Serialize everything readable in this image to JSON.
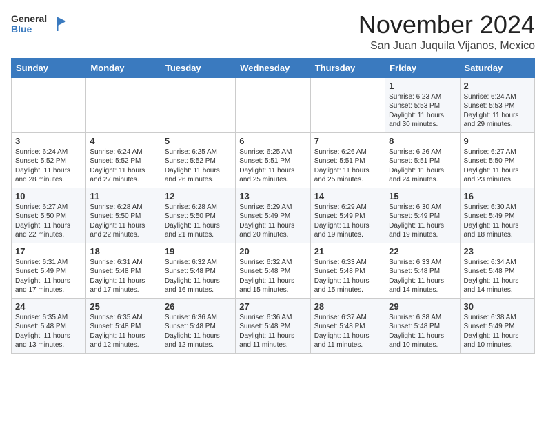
{
  "header": {
    "logo_general": "General",
    "logo_blue": "Blue",
    "month": "November 2024",
    "location": "San Juan Juquila Vijanos, Mexico"
  },
  "weekdays": [
    "Sunday",
    "Monday",
    "Tuesday",
    "Wednesday",
    "Thursday",
    "Friday",
    "Saturday"
  ],
  "weeks": [
    [
      {
        "day": "",
        "info": ""
      },
      {
        "day": "",
        "info": ""
      },
      {
        "day": "",
        "info": ""
      },
      {
        "day": "",
        "info": ""
      },
      {
        "day": "",
        "info": ""
      },
      {
        "day": "1",
        "info": "Sunrise: 6:23 AM\nSunset: 5:53 PM\nDaylight: 11 hours\nand 30 minutes."
      },
      {
        "day": "2",
        "info": "Sunrise: 6:24 AM\nSunset: 5:53 PM\nDaylight: 11 hours\nand 29 minutes."
      }
    ],
    [
      {
        "day": "3",
        "info": "Sunrise: 6:24 AM\nSunset: 5:52 PM\nDaylight: 11 hours\nand 28 minutes."
      },
      {
        "day": "4",
        "info": "Sunrise: 6:24 AM\nSunset: 5:52 PM\nDaylight: 11 hours\nand 27 minutes."
      },
      {
        "day": "5",
        "info": "Sunrise: 6:25 AM\nSunset: 5:52 PM\nDaylight: 11 hours\nand 26 minutes."
      },
      {
        "day": "6",
        "info": "Sunrise: 6:25 AM\nSunset: 5:51 PM\nDaylight: 11 hours\nand 25 minutes."
      },
      {
        "day": "7",
        "info": "Sunrise: 6:26 AM\nSunset: 5:51 PM\nDaylight: 11 hours\nand 25 minutes."
      },
      {
        "day": "8",
        "info": "Sunrise: 6:26 AM\nSunset: 5:51 PM\nDaylight: 11 hours\nand 24 minutes."
      },
      {
        "day": "9",
        "info": "Sunrise: 6:27 AM\nSunset: 5:50 PM\nDaylight: 11 hours\nand 23 minutes."
      }
    ],
    [
      {
        "day": "10",
        "info": "Sunrise: 6:27 AM\nSunset: 5:50 PM\nDaylight: 11 hours\nand 22 minutes."
      },
      {
        "day": "11",
        "info": "Sunrise: 6:28 AM\nSunset: 5:50 PM\nDaylight: 11 hours\nand 22 minutes."
      },
      {
        "day": "12",
        "info": "Sunrise: 6:28 AM\nSunset: 5:50 PM\nDaylight: 11 hours\nand 21 minutes."
      },
      {
        "day": "13",
        "info": "Sunrise: 6:29 AM\nSunset: 5:49 PM\nDaylight: 11 hours\nand 20 minutes."
      },
      {
        "day": "14",
        "info": "Sunrise: 6:29 AM\nSunset: 5:49 PM\nDaylight: 11 hours\nand 19 minutes."
      },
      {
        "day": "15",
        "info": "Sunrise: 6:30 AM\nSunset: 5:49 PM\nDaylight: 11 hours\nand 19 minutes."
      },
      {
        "day": "16",
        "info": "Sunrise: 6:30 AM\nSunset: 5:49 PM\nDaylight: 11 hours\nand 18 minutes."
      }
    ],
    [
      {
        "day": "17",
        "info": "Sunrise: 6:31 AM\nSunset: 5:49 PM\nDaylight: 11 hours\nand 17 minutes."
      },
      {
        "day": "18",
        "info": "Sunrise: 6:31 AM\nSunset: 5:48 PM\nDaylight: 11 hours\nand 17 minutes."
      },
      {
        "day": "19",
        "info": "Sunrise: 6:32 AM\nSunset: 5:48 PM\nDaylight: 11 hours\nand 16 minutes."
      },
      {
        "day": "20",
        "info": "Sunrise: 6:32 AM\nSunset: 5:48 PM\nDaylight: 11 hours\nand 15 minutes."
      },
      {
        "day": "21",
        "info": "Sunrise: 6:33 AM\nSunset: 5:48 PM\nDaylight: 11 hours\nand 15 minutes."
      },
      {
        "day": "22",
        "info": "Sunrise: 6:33 AM\nSunset: 5:48 PM\nDaylight: 11 hours\nand 14 minutes."
      },
      {
        "day": "23",
        "info": "Sunrise: 6:34 AM\nSunset: 5:48 PM\nDaylight: 11 hours\nand 14 minutes."
      }
    ],
    [
      {
        "day": "24",
        "info": "Sunrise: 6:35 AM\nSunset: 5:48 PM\nDaylight: 11 hours\nand 13 minutes."
      },
      {
        "day": "25",
        "info": "Sunrise: 6:35 AM\nSunset: 5:48 PM\nDaylight: 11 hours\nand 12 minutes."
      },
      {
        "day": "26",
        "info": "Sunrise: 6:36 AM\nSunset: 5:48 PM\nDaylight: 11 hours\nand 12 minutes."
      },
      {
        "day": "27",
        "info": "Sunrise: 6:36 AM\nSunset: 5:48 PM\nDaylight: 11 hours\nand 11 minutes."
      },
      {
        "day": "28",
        "info": "Sunrise: 6:37 AM\nSunset: 5:48 PM\nDaylight: 11 hours\nand 11 minutes."
      },
      {
        "day": "29",
        "info": "Sunrise: 6:38 AM\nSunset: 5:48 PM\nDaylight: 11 hours\nand 10 minutes."
      },
      {
        "day": "30",
        "info": "Sunrise: 6:38 AM\nSunset: 5:49 PM\nDaylight: 11 hours\nand 10 minutes."
      }
    ]
  ]
}
